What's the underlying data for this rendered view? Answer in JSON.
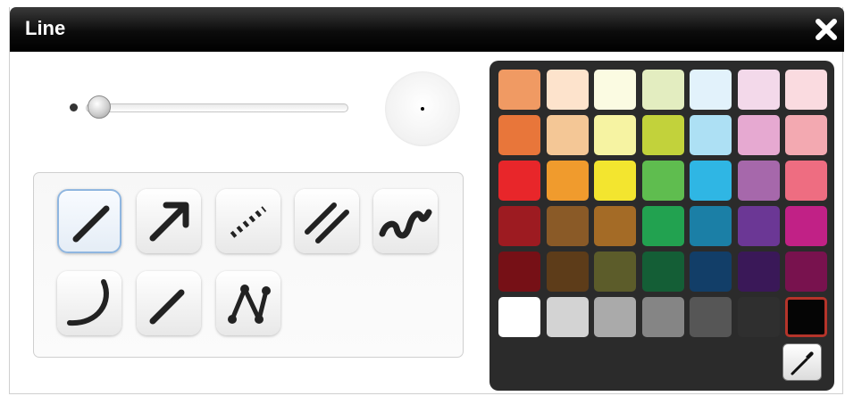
{
  "dialog": {
    "title": "Line",
    "close_icon": "close-x-icon"
  },
  "thickness": {
    "value": 0.05
  },
  "tools": [
    {
      "name": "straight-line-tool",
      "icon": "straight-line-icon",
      "selected": true
    },
    {
      "name": "arrow-line-tool",
      "icon": "arrow-line-icon",
      "selected": false
    },
    {
      "name": "dotted-line-tool",
      "icon": "dotted-line-icon",
      "selected": false
    },
    {
      "name": "double-line-tool",
      "icon": "double-line-icon",
      "selected": false
    },
    {
      "name": "freehand-line-tool",
      "icon": "freehand-line-icon",
      "selected": false
    },
    {
      "name": "arc-line-tool",
      "icon": "arc-line-icon",
      "selected": false
    },
    {
      "name": "angle-line-tool",
      "icon": "angle-line-icon",
      "selected": false
    },
    {
      "name": "polyline-tool",
      "icon": "polyline-icon",
      "selected": false
    }
  ],
  "palette": {
    "rows": [
      [
        "#f09a63",
        "#fde3cc",
        "#fbfbe2",
        "#e3edc0",
        "#e2f2fb",
        "#f3d9ea",
        "#fadbe0"
      ],
      [
        "#e8763a",
        "#f4c796",
        "#f6f3a2",
        "#c2d23b",
        "#ade0f4",
        "#e6a9d1",
        "#f3a9b1"
      ],
      [
        "#e8262a",
        "#f09b2d",
        "#f3e52f",
        "#5fbd4f",
        "#2fb6e4",
        "#a668ab",
        "#ee6d81"
      ],
      [
        "#9d1b21",
        "#8a5a27",
        "#a46b26",
        "#22a250",
        "#1b7fa6",
        "#6b3795",
        "#c12186"
      ],
      [
        "#761016",
        "#5d3c19",
        "#5c5c2a",
        "#145e36",
        "#123e68",
        "#3a1858",
        "#78124e"
      ],
      [
        "#ffffff",
        "#d3d3d3",
        "#aaaaaa",
        "#858585",
        "#565656",
        "#2f2f2f",
        "#050505"
      ]
    ],
    "selected": "#050505",
    "eyedropper_icon": "eyedropper-icon"
  }
}
